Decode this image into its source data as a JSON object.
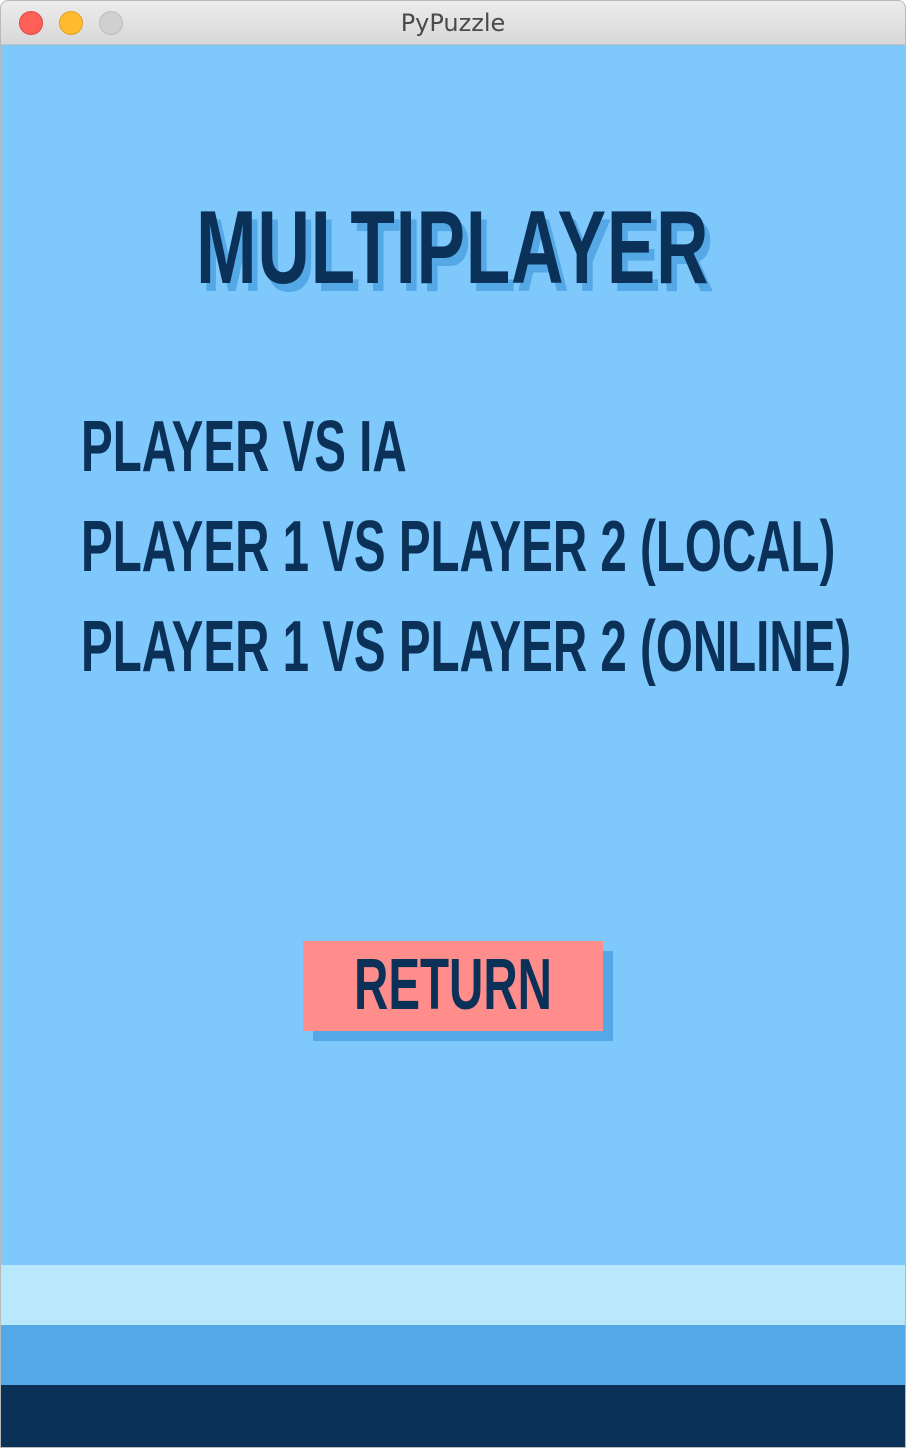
{
  "window": {
    "title": "PyPuzzle"
  },
  "screen": {
    "heading": "MULTIPLAYER",
    "menu_items": [
      "PLAYER VS IA",
      "PLAYER 1 VS PLAYER 2 (LOCAL)",
      "PLAYER 1 VS PLAYER 2 (ONLINE)"
    ],
    "return_label": "RETURN"
  },
  "colors": {
    "background": "#7ec8fc",
    "text": "#0b3158",
    "shadow": "#55a8e6",
    "return_button": "#ff8d8b",
    "band_light": "#b9e7fb",
    "band_mid": "#55a8e6",
    "band_dark": "#0b3158"
  }
}
